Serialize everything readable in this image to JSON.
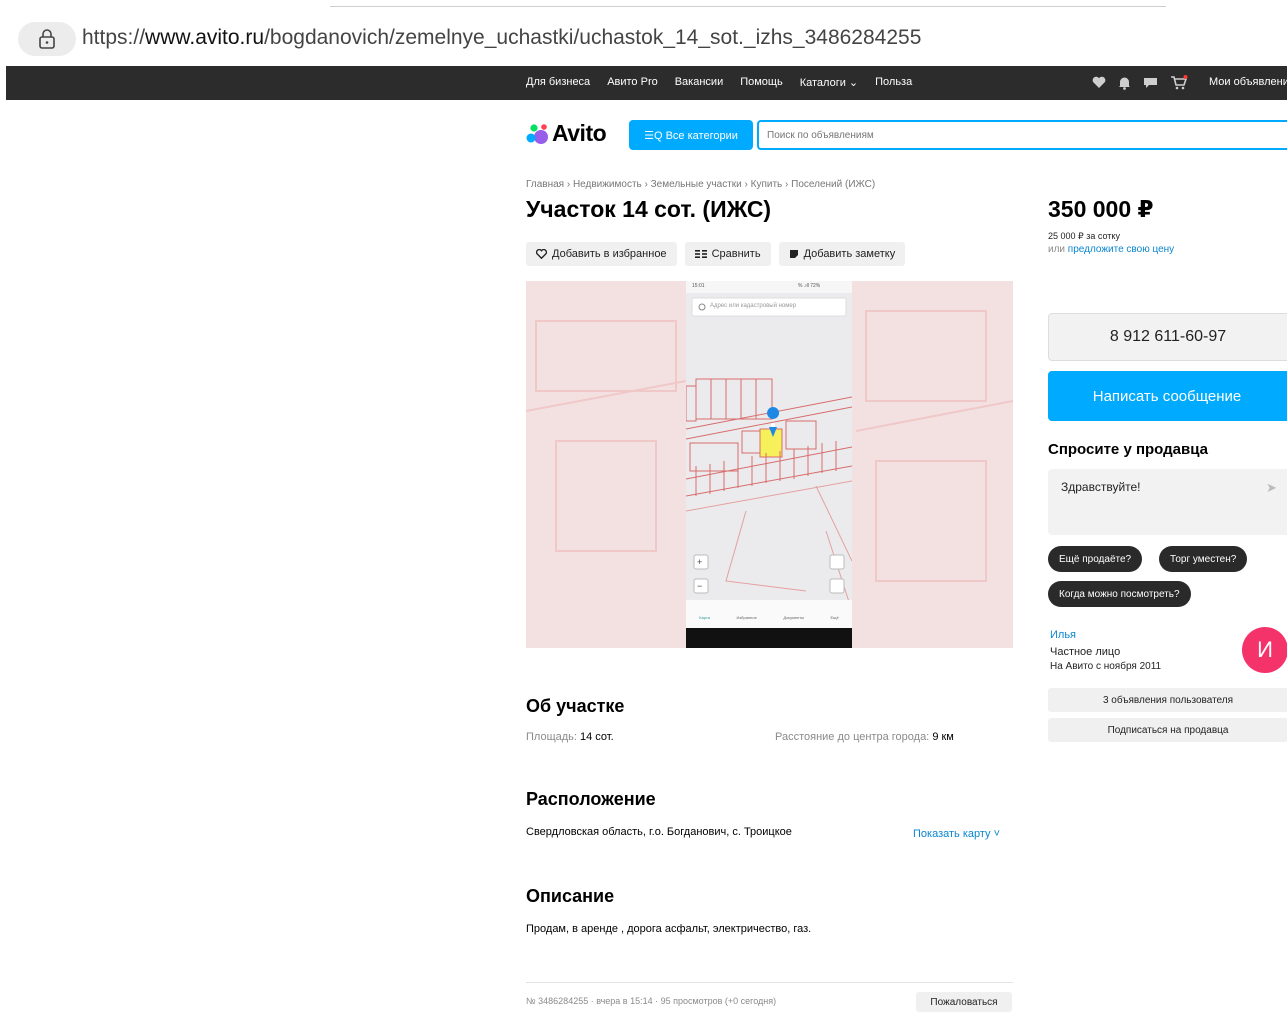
{
  "browser": {
    "url_prefix": "https://",
    "url_domain": "www.avito.ru",
    "url_path": "/bogdanovich/zemelnye_uchastki/uchastok_14_sot._izhs_3486284255"
  },
  "topnav": {
    "links": [
      "Для бизнеса",
      "Авито Pro",
      "Вакансии",
      "Помощь",
      "Каталоги ⌄",
      "Польза"
    ],
    "my_ads": "Мои объявления"
  },
  "header": {
    "logo": "Avito",
    "categories_button": "☰Q Все категории",
    "search_placeholder": "Поиск по объявлениям"
  },
  "breadcrumb": "Главная › Недвижимость › Земельные участки › Купить › Поселений (ИЖС)",
  "listing": {
    "title": "Участок 14 сот. (ИЖС)",
    "actions": {
      "favorite": "Добавить в избранное",
      "compare": "Сравнить",
      "note": "Добавить заметку"
    },
    "map_overlay": {
      "search_hint": "Адрес или кадастровый номер",
      "status_time": "15:01",
      "status_right": "% .ıll 72%",
      "tabs": [
        "Карта",
        "Избранное",
        "Документы",
        "Ещё"
      ]
    },
    "about": {
      "heading": "Об участке",
      "area_label": "Площадь:",
      "area_value": "14 сот.",
      "distance_label": "Расстояние до центра города:",
      "distance_value": "9 км"
    },
    "location": {
      "heading": "Расположение",
      "address": "Свердловская область, г.о. Богданович, с. Троицкое",
      "show_map": "Показать карту ˅"
    },
    "description": {
      "heading": "Описание",
      "text": "Продам, в аренде , дорога асфальт, электричество, газ."
    },
    "footer": {
      "meta": "№ 3486284255 · вчера в 15:14 · 95 просмотров (+0 сегодня)",
      "complain": "Пожаловаться"
    }
  },
  "sidebar": {
    "price": "350 000 ₽",
    "price_per_unit": "25 000 ₽ за сотку",
    "offer_prefix": "или",
    "offer_link": "предложите свою цену",
    "phone": "8 912 611-60-97",
    "write_message": "Написать сообщение",
    "ask_heading": "Спросите у продавца",
    "ask_text": "Здравствуйте!",
    "quick_questions": [
      "Ещё продаёте?",
      "Торг уместен?",
      "Когда можно посмотреть?"
    ],
    "seller": {
      "name": "Илья",
      "type": "Частное лицо",
      "since": "На Авито с ноября 2011",
      "avatar_letter": "И"
    },
    "user_ads": "3 объявления пользователя",
    "subscribe": "Подписаться на продавца"
  },
  "colors": {
    "accent": "#00aaff",
    "dark": "#2c2c2c",
    "avatar": "#f5336b",
    "link": "#0a86d0"
  }
}
